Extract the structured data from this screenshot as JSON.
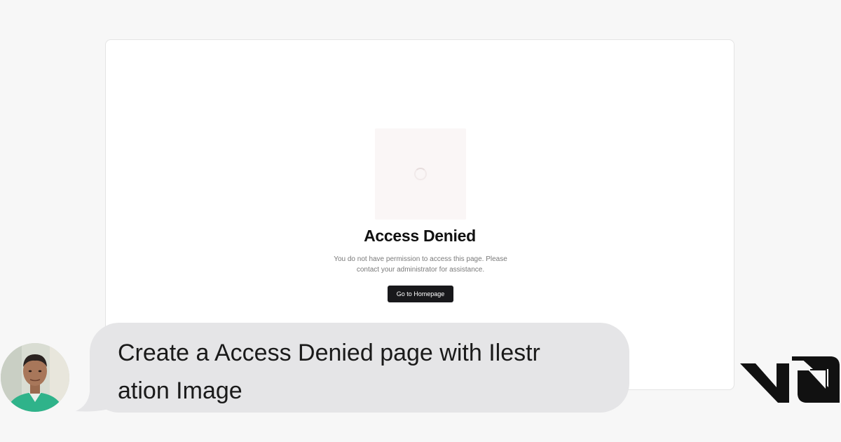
{
  "preview": {
    "heading": "Access Denied",
    "message_line1": "You do not have permission to access this page. Please",
    "message_line2": "contact your administrator for assistance.",
    "button_label": "Go to Homepage",
    "illustration_icon": "loading-spinner-icon"
  },
  "chat": {
    "avatar_icon": "user-avatar",
    "message_line1": "Create a Access Denied page with Ilestr",
    "message_line2": "ation Image",
    "bubble_color": "#e5e5e7"
  },
  "brand": {
    "logo_icon": "v0-logo-icon",
    "logo_color": "#111111"
  },
  "colors": {
    "button_background": "#18181b",
    "page_background": "#f7f7f7"
  }
}
